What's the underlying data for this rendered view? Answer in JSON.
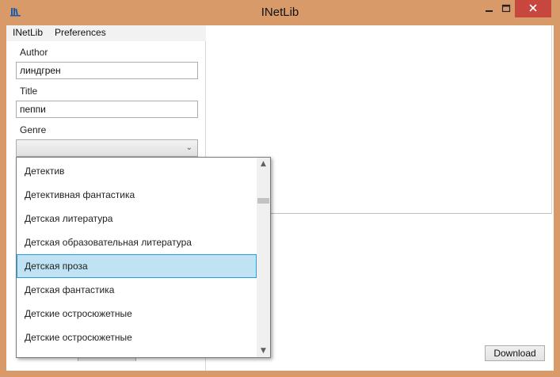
{
  "window": {
    "title": "INetLib",
    "frame_color": "#d99a69",
    "close_color": "#c7463e",
    "minimize_icon": "minimize-icon",
    "maximize_icon": "maximize-icon",
    "close_icon": "close-icon"
  },
  "menu": {
    "items": [
      {
        "label": "INetLib"
      },
      {
        "label": "Preferences"
      }
    ]
  },
  "search": {
    "author_label": "Author",
    "author_value": "линдгрен",
    "title_label": "Title",
    "title_value": "пеппи",
    "genre_label": "Genre",
    "genre_value": ""
  },
  "genre_dropdown": {
    "items": [
      {
        "label": "Детектив",
        "selected": false
      },
      {
        "label": "Детективная фантастика",
        "selected": false
      },
      {
        "label": "Детская литература",
        "selected": false
      },
      {
        "label": "Детская образовательная литература",
        "selected": false
      },
      {
        "label": "Детская проза",
        "selected": true
      },
      {
        "label": "Детская фантастика",
        "selected": false
      },
      {
        "label": "Детские остросюжетные",
        "selected": false
      },
      {
        "label": "Детские остросюжетные",
        "selected": false
      }
    ],
    "selection_color": "#bfe3f4"
  },
  "actions": {
    "download_label": "Download"
  }
}
